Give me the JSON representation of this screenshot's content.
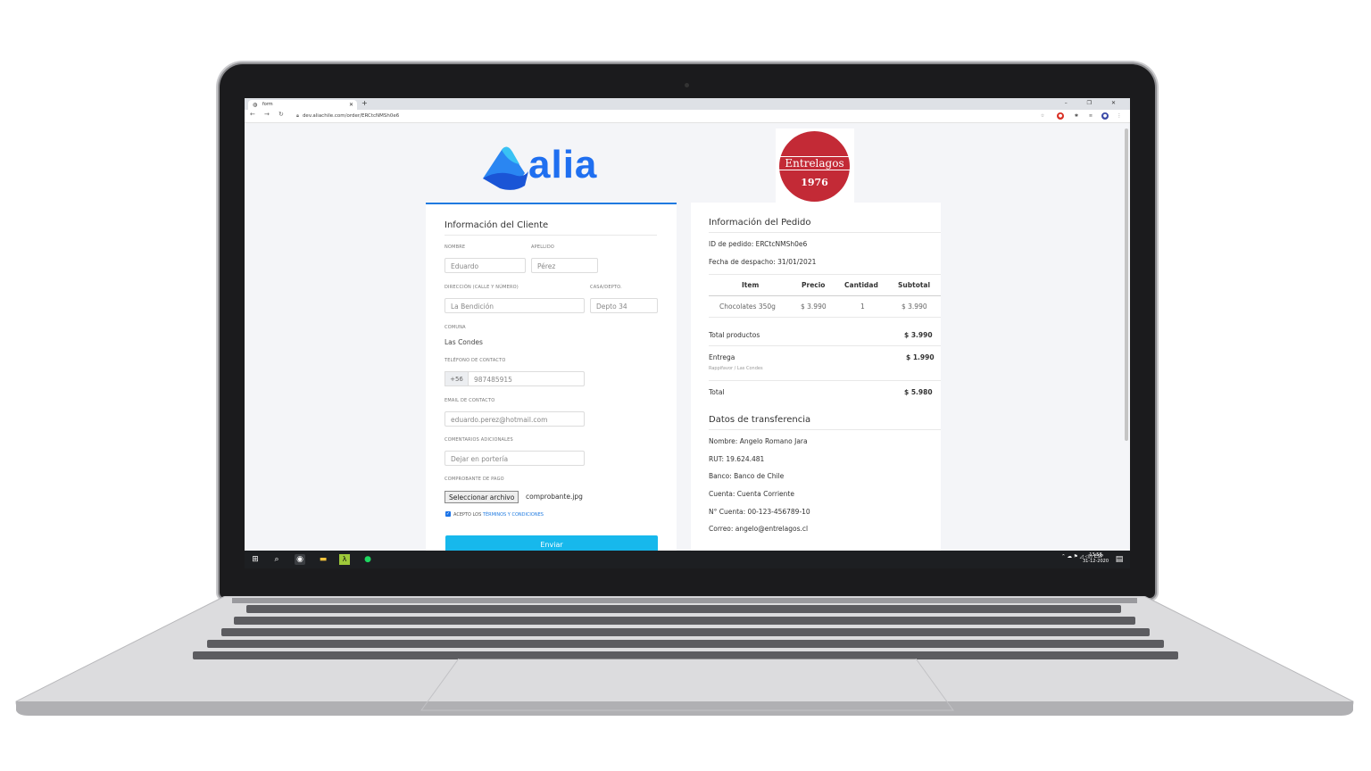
{
  "browser": {
    "tab_title": "form",
    "url": "dev.aliachile.com/order/ERCtcNMSh0e6",
    "new_tab": "+",
    "window_controls": "–  ❐  ✕"
  },
  "logos": {
    "alia": "alia",
    "entrelagos_name": "Entrelagos",
    "entrelagos_year": "1976"
  },
  "cliente": {
    "title": "Información del Cliente",
    "nombre_label": "NOMBRE",
    "nombre_placeholder": "Eduardo",
    "apellido_label": "APELLIDO",
    "apellido_placeholder": "Pérez",
    "direccion_label": "DIRECCIÓN (CALLE Y NÚMERO)",
    "direccion_placeholder": "La Bendición",
    "casa_label": "CASA/DEPTO.",
    "casa_placeholder": "Depto 34",
    "comuna_label": "COMUNA",
    "comuna_value": "Las Condes",
    "telefono_label": "TELÉFONO DE CONTACTO",
    "telefono_prefix": "+56",
    "telefono_placeholder": "987485915",
    "email_label": "EMAIL DE CONTACTO",
    "email_placeholder": "eduardo.perez@hotmail.com",
    "comentarios_label": "COMENTARIOS ADICIONALES",
    "comentarios_placeholder": "Dejar en portería",
    "comprobante_label": "COMPROBANTE DE PAGO",
    "file_button": "Seleccionar archivo",
    "file_name": "comprobante.jpg",
    "terms_prefix": "ACEPTO LOS ",
    "terms_link": "TÉRMINOS Y CONDICIONES",
    "submit": "Enviar"
  },
  "pedido": {
    "title": "Información del Pedido",
    "id_line": "ID de pedido: ERCtcNMSh0e6",
    "fecha_line": "Fecha de despacho: 31/01/2021",
    "table_headers": [
      "Item",
      "Precio",
      "Cantidad",
      "Subtotal"
    ],
    "rows": [
      {
        "item": "Chocolates 350g",
        "precio": "$ 3.990",
        "cantidad": "1",
        "subtotal": "$ 3.990"
      }
    ],
    "total_productos_label": "Total productos",
    "total_productos_value": "$ 3.990",
    "entrega_label": "Entrega",
    "entrega_value": "$ 1.990",
    "entrega_sub": "Rappifavor / Las Condes",
    "total_label": "Total",
    "total_value": "$ 5.980"
  },
  "transferencia": {
    "title": "Datos de transferencia",
    "nombre": "Nombre: Angelo Romano Jara",
    "rut": "RUT: 19.624.481",
    "banco": "Banco: Banco de Chile",
    "cuenta": "Cuenta: Cuenta Corriente",
    "numero": "N° Cuenta: 00-123-456789-10",
    "correo": "Correo: angelo@entrelagos.cl"
  },
  "taskbar": {
    "lang": "ESP",
    "time": "13:58",
    "date": "31-12-2020"
  },
  "colors": {
    "accent_blue": "#1f7ae0",
    "submit_cyan": "#17b8ec",
    "entrelagos_red": "#c32a36"
  }
}
